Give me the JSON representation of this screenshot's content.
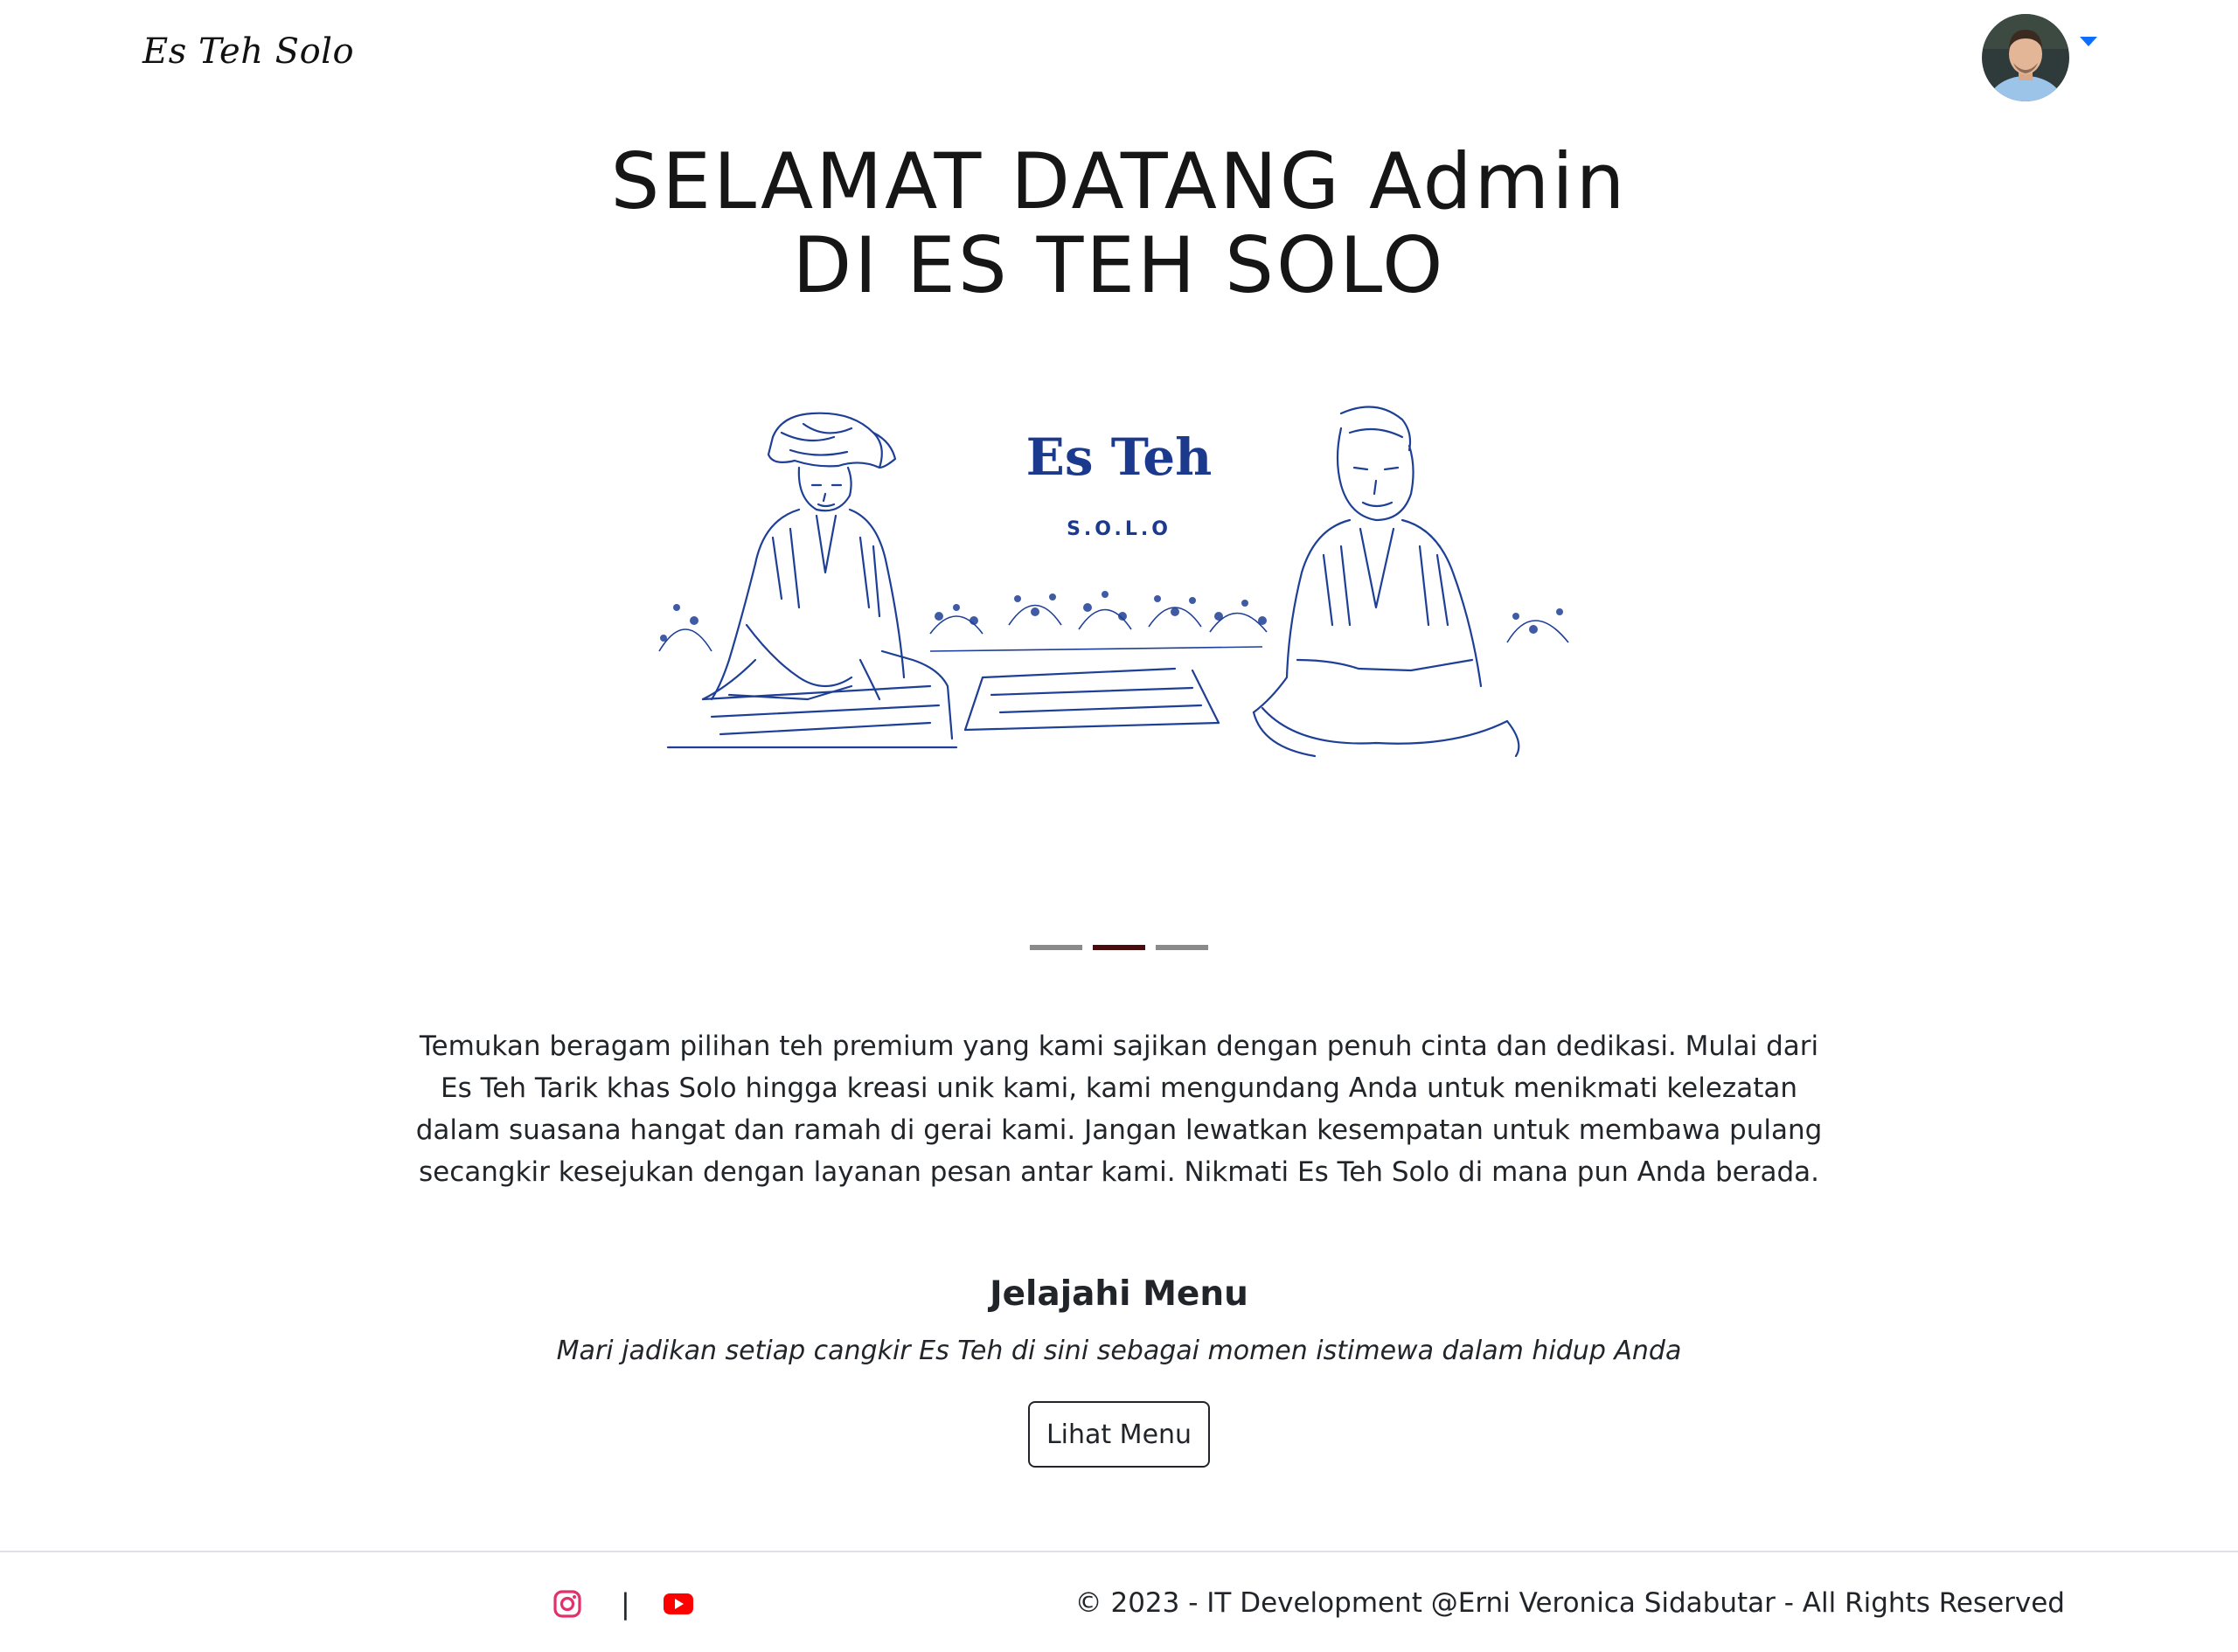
{
  "navbar": {
    "brand": "Es Teh Solo",
    "user_avatar": "user-avatar",
    "dropdown_icon": "caret-down-icon",
    "accent_color": "#0d6efd"
  },
  "hero": {
    "title_line1": "SELAMAT DATANG Admin",
    "title_line2": "DI ES TEH SOLO"
  },
  "carousel": {
    "logo_title": "Es Teh",
    "logo_subtitle": "S.O.L.O",
    "illustration_color": "#1e3f96",
    "slide_count": 3,
    "active_slide": 2
  },
  "description": "Temukan beragam pilihan teh premium yang kami sajikan dengan penuh cinta dan dedikasi. Mulai dari Es Teh Tarik khas Solo hingga kreasi unik kami, kami mengundang Anda untuk menikmati kelezatan dalam suasana hangat dan ramah di gerai kami. Jangan lewatkan kesempatan untuk membawa pulang secangkir kesejukan dengan layanan pesan antar kami. Nikmati Es Teh Solo di mana pun Anda berada.",
  "explore": {
    "heading": "Jelajahi Menu",
    "subtitle": "Mari jadikan setiap cangkir Es Teh di sini sebagai momen istimewa dalam hidup Anda",
    "button_label": "Lihat Menu"
  },
  "footer": {
    "social": [
      {
        "icon": "instagram-icon",
        "color": "#e1306c"
      },
      {
        "icon": "youtube-icon",
        "color": "#ff0000"
      }
    ],
    "divider": "|",
    "copyright": "© 2023 - IT Development @Erni Veronica Sidabutar - All Rights Reserved"
  }
}
